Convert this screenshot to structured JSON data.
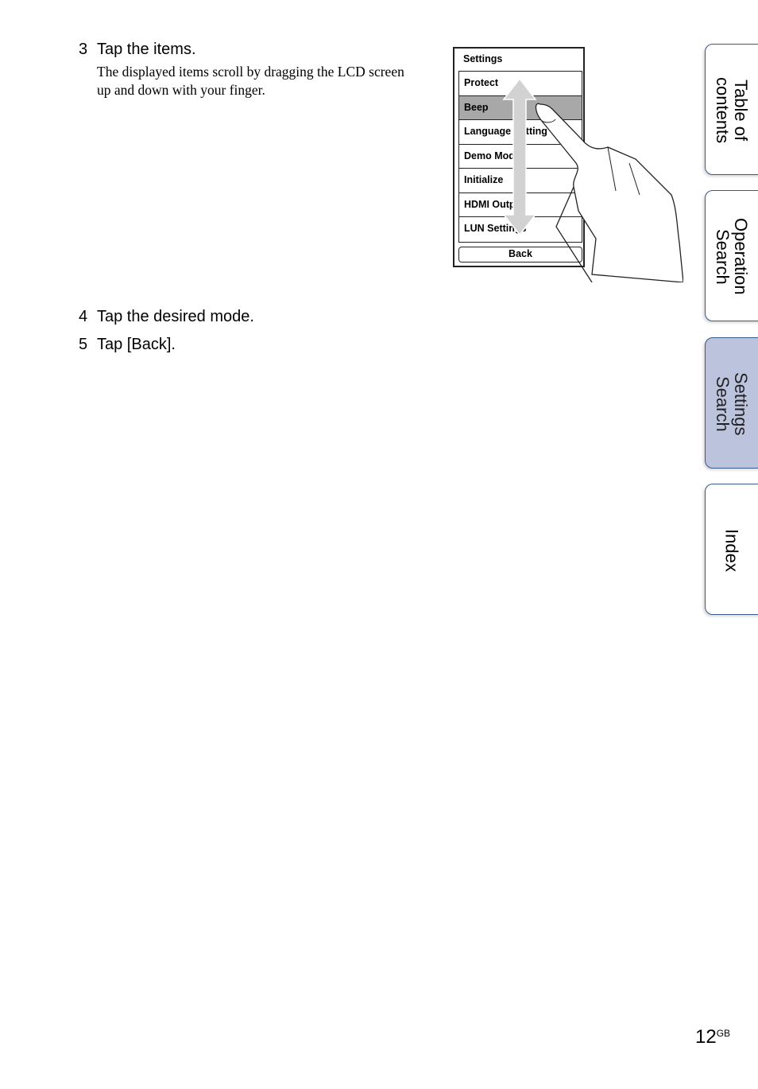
{
  "steps": [
    {
      "number": "3",
      "text": "Tap the items.",
      "description": "The displayed items scroll by dragging the LCD screen up and down with your finger."
    },
    {
      "number": "4",
      "text": "Tap the desired mode."
    },
    {
      "number": "5",
      "text": "Tap [Back]."
    }
  ],
  "illustration": {
    "screen_title": "Settings",
    "items": [
      "Protect",
      "Beep",
      "Language Setting",
      "Demo Mode",
      "Initialize",
      "HDMI Output",
      "LUN Settings"
    ],
    "selected_item": "Beep",
    "back_label": "Back",
    "gesture": "drag-up-down"
  },
  "side_tabs": [
    {
      "label": "Table of\ncontents",
      "active": false
    },
    {
      "label": "Operation\nSearch",
      "active": false
    },
    {
      "label": "Settings\nSearch",
      "active": true
    },
    {
      "label": "Index",
      "active": false
    }
  ],
  "footer": {
    "page_number": "12",
    "suffix": "GB"
  },
  "colors": {
    "tab_border": "#3a5a8a",
    "tab_active_bg": "#bcc3dd",
    "selected_row": "#a8a8a8"
  }
}
